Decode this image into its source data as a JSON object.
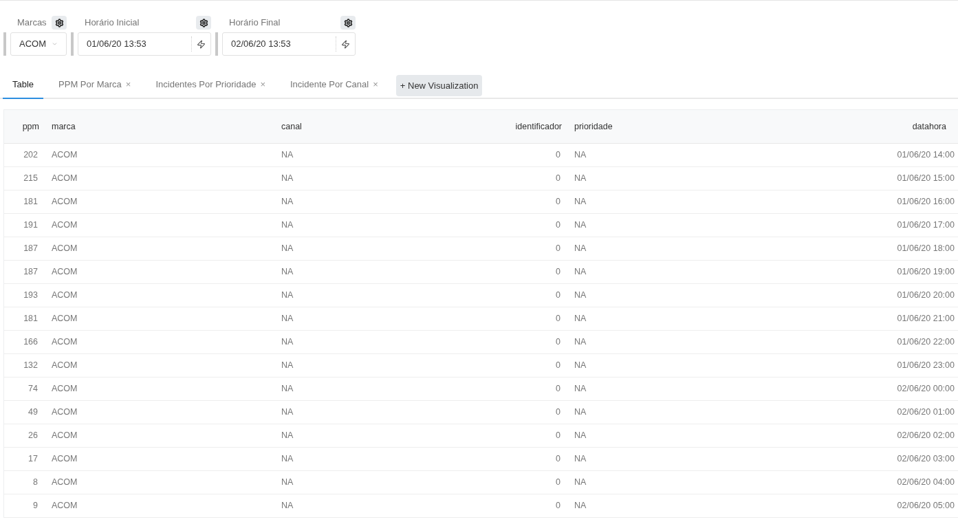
{
  "filters": [
    {
      "kind": "select",
      "label": "Marcas",
      "value": "ACOM"
    },
    {
      "kind": "datetime",
      "label": "Horário Inicial",
      "value": "01/06/20 13:53"
    },
    {
      "kind": "datetime",
      "label": "Horário Final",
      "value": "02/06/20 13:53"
    }
  ],
  "tabs": [
    {
      "label": "Table",
      "closable": false,
      "selected": true
    },
    {
      "label": "PPM Por Marca",
      "closable": true,
      "selected": false
    },
    {
      "label": "Incidentes Por Prioridade",
      "closable": true,
      "selected": false
    },
    {
      "label": "Incidente Por Canal",
      "closable": true,
      "selected": false
    }
  ],
  "tab_close_symbol": "×",
  "new_visualization": {
    "icon": "+",
    "label": "New Visualization"
  },
  "table": {
    "columns": [
      {
        "label": "ppm",
        "kind": "number"
      },
      {
        "label": "marca",
        "kind": "text"
      },
      {
        "label": "canal",
        "kind": "text"
      },
      {
        "label": "identificador",
        "kind": "number"
      },
      {
        "label": "prioridade",
        "kind": "text"
      },
      {
        "label": "datahora",
        "kind": "datetime"
      }
    ],
    "rows": [
      [
        "202",
        "ACOM",
        "NA",
        "0",
        "NA",
        "01/06/20 14:00"
      ],
      [
        "215",
        "ACOM",
        "NA",
        "0",
        "NA",
        "01/06/20 15:00"
      ],
      [
        "181",
        "ACOM",
        "NA",
        "0",
        "NA",
        "01/06/20 16:00"
      ],
      [
        "191",
        "ACOM",
        "NA",
        "0",
        "NA",
        "01/06/20 17:00"
      ],
      [
        "187",
        "ACOM",
        "NA",
        "0",
        "NA",
        "01/06/20 18:00"
      ],
      [
        "187",
        "ACOM",
        "NA",
        "0",
        "NA",
        "01/06/20 19:00"
      ],
      [
        "193",
        "ACOM",
        "NA",
        "0",
        "NA",
        "01/06/20 20:00"
      ],
      [
        "181",
        "ACOM",
        "NA",
        "0",
        "NA",
        "01/06/20 21:00"
      ],
      [
        "166",
        "ACOM",
        "NA",
        "0",
        "NA",
        "01/06/20 22:00"
      ],
      [
        "132",
        "ACOM",
        "NA",
        "0",
        "NA",
        "01/06/20 23:00"
      ],
      [
        "74",
        "ACOM",
        "NA",
        "0",
        "NA",
        "02/06/20 00:00"
      ],
      [
        "49",
        "ACOM",
        "NA",
        "0",
        "NA",
        "02/06/20 01:00"
      ],
      [
        "26",
        "ACOM",
        "NA",
        "0",
        "NA",
        "02/06/20 02:00"
      ],
      [
        "17",
        "ACOM",
        "NA",
        "0",
        "NA",
        "02/06/20 03:00"
      ],
      [
        "8",
        "ACOM",
        "NA",
        "0",
        "NA",
        "02/06/20 04:00"
      ],
      [
        "9",
        "ACOM",
        "NA",
        "0",
        "NA",
        "02/06/20 05:00"
      ]
    ]
  }
}
